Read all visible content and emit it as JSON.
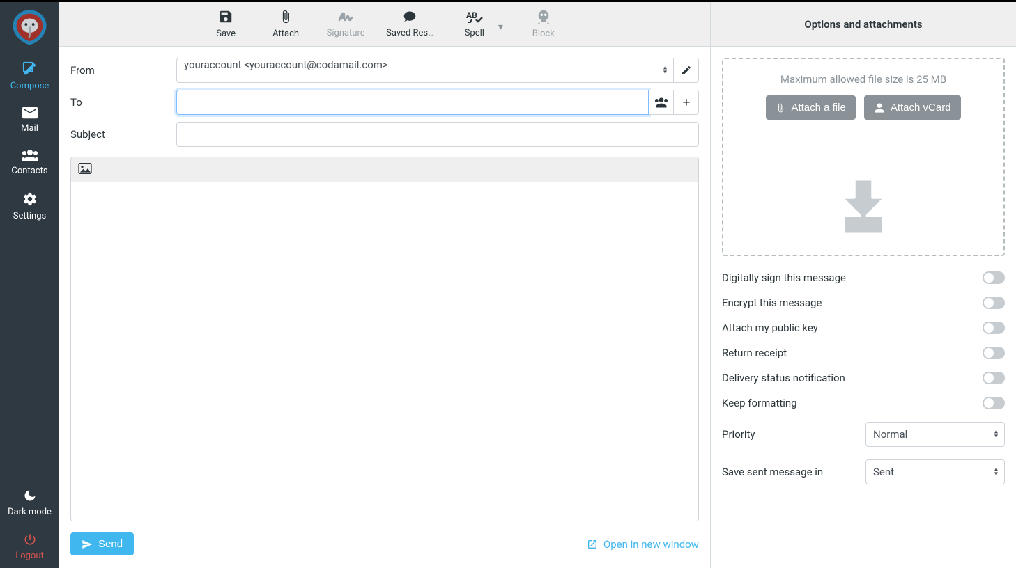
{
  "sidebar": {
    "items": [
      {
        "label": "Compose"
      },
      {
        "label": "Mail"
      },
      {
        "label": "Contacts"
      },
      {
        "label": "Settings"
      }
    ],
    "dark": "Dark mode",
    "logout": "Logout"
  },
  "toolbar": {
    "save": "Save",
    "attach": "Attach",
    "signature": "Signature",
    "saved": "Saved Res…",
    "spell": "Spell",
    "block": "Block"
  },
  "form": {
    "from_label": "From",
    "from_value": "youraccount <youraccount@codamail.com>",
    "to_label": "To",
    "to_value": "",
    "subject_label": "Subject",
    "subject_value": ""
  },
  "footer": {
    "send": "Send",
    "open": "Open in new window"
  },
  "right": {
    "title": "Options and attachments",
    "maxsize": "Maximum allowed file size is 25 MB",
    "attach_file": "Attach a file",
    "attach_vcard": "Attach vCard",
    "options": [
      "Digitally sign this message",
      "Encrypt this message",
      "Attach my public key",
      "Return receipt",
      "Delivery status notification",
      "Keep formatting"
    ],
    "priority_label": "Priority",
    "priority_value": "Normal",
    "savein_label": "Save sent message in",
    "savein_value": "Sent"
  }
}
